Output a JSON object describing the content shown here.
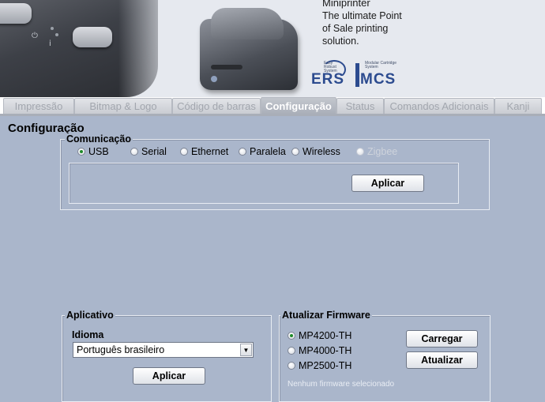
{
  "banner": {
    "product_line": "Miniprinter",
    "tagline_1": "The ultimate Point",
    "tagline_2": "of Sale printing",
    "tagline_3": "solution.",
    "ers_logo": "ERS",
    "ers_small": "Easy Robust System",
    "mcs_logo": "MCS",
    "mcs_small": "Modular Cartridge System"
  },
  "tabs": [
    {
      "label": "Impressão",
      "active": false
    },
    {
      "label": "Bitmap & Logo",
      "active": false
    },
    {
      "label": "Código de barras",
      "active": false
    },
    {
      "label": "Configuração",
      "active": true
    },
    {
      "label": "Status",
      "active": false
    },
    {
      "label": "Comandos Adicionais",
      "active": false
    },
    {
      "label": "Kanji",
      "active": false
    }
  ],
  "page": {
    "title": "Configuração"
  },
  "comunicacao": {
    "label": "Comunicação",
    "options": [
      {
        "label": "USB",
        "checked": true,
        "enabled": true
      },
      {
        "label": "Serial",
        "checked": false,
        "enabled": true
      },
      {
        "label": "Ethernet",
        "checked": false,
        "enabled": true
      },
      {
        "label": "Paralela",
        "checked": false,
        "enabled": true
      },
      {
        "label": "Wireless",
        "checked": false,
        "enabled": true
      },
      {
        "label": "Zigbee",
        "checked": false,
        "enabled": false
      }
    ],
    "apply_label": "Aplicar"
  },
  "aplicativo": {
    "label": "Aplicativo",
    "idioma_label": "Idioma",
    "idioma_value": "Português brasileiro",
    "apply_label": "Aplicar"
  },
  "firmware": {
    "label": "Atualizar Firmware",
    "options": [
      {
        "label": "MP4200-TH",
        "checked": true
      },
      {
        "label": "MP4000-TH",
        "checked": false
      },
      {
        "label": "MP2500-TH",
        "checked": false
      }
    ],
    "load_label": "Carregar",
    "update_label": "Atualizar",
    "status": "Nenhum firmware selecionado"
  },
  "colors": {
    "background": "#aab6cb",
    "active_tab": "#a9aeb8",
    "radio_dot": "#1f8a2a"
  }
}
